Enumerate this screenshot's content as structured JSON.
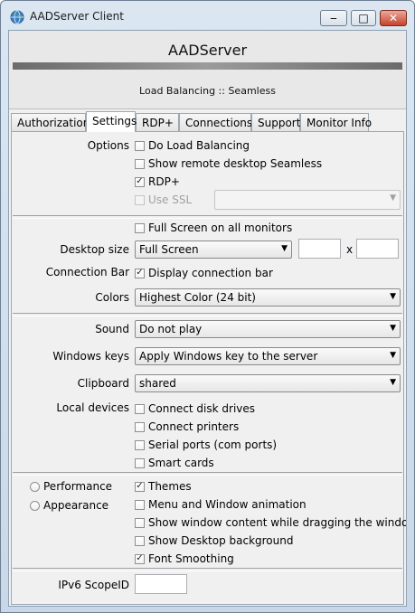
{
  "window": {
    "title": "AADServer Client",
    "icon": "globe-icon"
  },
  "header": {
    "app_name": "AADServer",
    "subtitle": "Load Balancing :: Seamless"
  },
  "tabs": [
    "Authorization",
    "Settings",
    "RDP+",
    "Connections",
    "Support",
    "Monitor Info"
  ],
  "active_tab": "Settings",
  "options": {
    "label": "Options",
    "do_load_balancing": {
      "label": "Do Load Balancing",
      "checked": false
    },
    "seamless": {
      "label": "Show remote desktop Seamless",
      "checked": false
    },
    "rdp_plus": {
      "label": "RDP+",
      "checked": true
    },
    "use_ssl": {
      "label": "Use SSL",
      "checked": false,
      "enabled": false
    },
    "ssl_select": {
      "value": ""
    }
  },
  "display": {
    "full_screen_all": {
      "label": "Full Screen on all monitors",
      "checked": false
    },
    "desktop_size_label": "Desktop size",
    "desktop_size": "Full Screen",
    "x_sep": "x",
    "connection_bar_label": "Connection Bar",
    "connection_bar": {
      "label": "Display connection bar",
      "checked": true
    },
    "colors_label": "Colors",
    "colors": "Highest Color (24 bit)"
  },
  "resources": {
    "sound_label": "Sound",
    "sound": "Do not play",
    "windows_keys_label": "Windows keys",
    "windows_keys": "Apply Windows key to the server",
    "clipboard_label": "Clipboard",
    "clipboard": "shared",
    "local_devices_label": "Local devices",
    "devices": [
      {
        "label": "Connect disk drives",
        "checked": false
      },
      {
        "label": "Connect printers",
        "checked": false
      },
      {
        "label": "Serial ports (com ports)",
        "checked": false
      },
      {
        "label": "Smart cards",
        "checked": false
      }
    ]
  },
  "experience": {
    "radios": [
      {
        "label": "Performance",
        "selected": false
      },
      {
        "label": "Appearance",
        "selected": false
      }
    ],
    "items": [
      {
        "label": "Themes",
        "checked": true
      },
      {
        "label": "Menu and Window animation",
        "checked": false
      },
      {
        "label": "Show window content while dragging the window",
        "checked": false
      },
      {
        "label": "Show Desktop background",
        "checked": false
      },
      {
        "label": "Font Smoothing",
        "checked": true
      }
    ]
  },
  "ipv6": {
    "label": "IPv6 ScopeID",
    "value": ""
  },
  "check_mark": "✓",
  "caption": {
    "minimize": "‒",
    "maximize": "□",
    "close": "✕"
  }
}
